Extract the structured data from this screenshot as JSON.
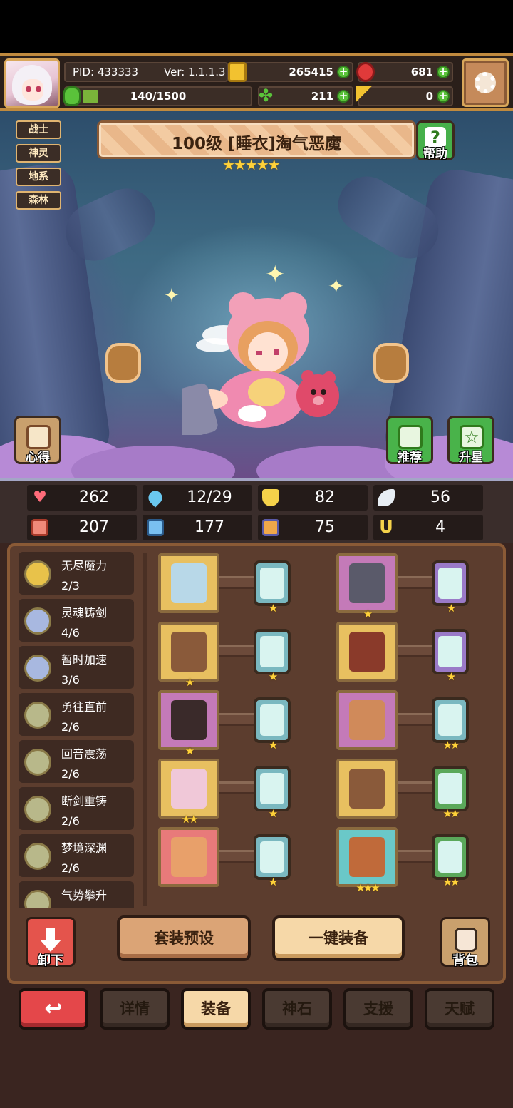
{
  "header": {
    "pid": "PID: 433333",
    "version": "Ver: 1.1.1.3",
    "gold": "265415",
    "ruby": "681",
    "energy": "140/1500",
    "energy_fraction": 0.093,
    "clover": "211",
    "keys": "0"
  },
  "hero": {
    "tags": [
      "战士",
      "神灵",
      "地系",
      "森林"
    ],
    "title": "100级 [睡衣]淘气恶魔",
    "stars": "★★★★★",
    "help_label": "帮助",
    "tips_label": "心得",
    "recommend_label": "推荐",
    "upstar_label": "升星"
  },
  "stats": [
    {
      "icon": "heart-icon",
      "value": "262",
      "color": "#ff6b7a"
    },
    {
      "icon": "water-drop-icon",
      "value": "12/29",
      "color": "#6ac8f0"
    },
    {
      "icon": "shield-icon",
      "value": "82",
      "color": "#f5d24a"
    },
    {
      "icon": "wing-icon",
      "value": "56",
      "color": "#e8eef4"
    },
    {
      "icon": "fist-icon",
      "value": "207",
      "color": "#f08a7a"
    },
    {
      "icon": "book-icon",
      "value": "177",
      "color": "#7ac0f0"
    },
    {
      "icon": "scroll-icon",
      "value": "75",
      "color": "#f0a84a"
    },
    {
      "icon": "horseshoe-icon",
      "value": "4",
      "color": "#f5d24a"
    }
  ],
  "skills": [
    {
      "name": "无尽魔力",
      "level": "2/3",
      "color": "#e8c24a"
    },
    {
      "name": "灵魂铸剑",
      "level": "4/6",
      "color": "#a8b8e0"
    },
    {
      "name": "暂时加速",
      "level": "3/6",
      "color": "#a8b8e0"
    },
    {
      "name": "勇往直前",
      "level": "2/6",
      "color": "#b8b88a"
    },
    {
      "name": "回音震荡",
      "level": "2/6",
      "color": "#b8b88a"
    },
    {
      "name": "断剑重铸",
      "level": "2/6",
      "color": "#b8b88a"
    },
    {
      "name": "梦境深渊",
      "level": "2/6",
      "color": "#b8b88a"
    },
    {
      "name": "气势攀升",
      "level": "",
      "color": "#b8b88a"
    }
  ],
  "equipment": [
    {
      "slot": "sword",
      "bg": "#e8c060",
      "art": "#b8d8e8",
      "stars": "",
      "gem_bg": "#7ab8c0",
      "gem_stars": "★"
    },
    {
      "slot": "helmet",
      "bg": "#c47ab8",
      "art": "#5a5a6a",
      "stars": "★",
      "gem_bg": "#9a7ac8",
      "gem_stars": "★"
    },
    {
      "slot": "armor",
      "bg": "#e8c060",
      "art": "#8a5a3a",
      "stars": "★",
      "gem_bg": "#7ab8c0",
      "gem_stars": "★"
    },
    {
      "slot": "gauntlet-armor",
      "bg": "#e8c060",
      "art": "#8a3a2a",
      "stars": "",
      "gem_bg": "#9a7ac8",
      "gem_stars": "★"
    },
    {
      "slot": "necklace",
      "bg": "#c47ab8",
      "art": "#3a2a2a",
      "stars": "★",
      "gem_bg": "#7ab8c0",
      "gem_stars": "★"
    },
    {
      "slot": "glove",
      "bg": "#c47ab8",
      "art": "#d08a5a",
      "stars": "",
      "gem_bg": "#7ab8c0",
      "gem_stars": "★★"
    },
    {
      "slot": "charm",
      "bg": "#e8c060",
      "art": "#f0c8d8",
      "stars": "★★",
      "gem_bg": "#7ab8c0",
      "gem_stars": "★"
    },
    {
      "slot": "belt",
      "bg": "#e8c060",
      "art": "#8a5a3a",
      "stars": "",
      "gem_bg": "#5aa85a",
      "gem_stars": "★★"
    },
    {
      "slot": "ring",
      "bg": "#e87a7a",
      "art": "#e8a06a",
      "stars": "",
      "gem_bg": "#7ab8c0",
      "gem_stars": "★"
    },
    {
      "slot": "boots",
      "bg": "#6ac8c8",
      "art": "#c06a3a",
      "stars": "★★★",
      "gem_bg": "#5aa85a",
      "gem_stars": "★★"
    }
  ],
  "buttons": {
    "unequip": "卸下",
    "preset": "套装预设",
    "equip_all": "一键装备",
    "bag": "背包"
  },
  "tabs": {
    "back": "↩",
    "items": [
      "详情",
      "装备",
      "神石",
      "支援",
      "天赋"
    ],
    "active": "装备"
  }
}
